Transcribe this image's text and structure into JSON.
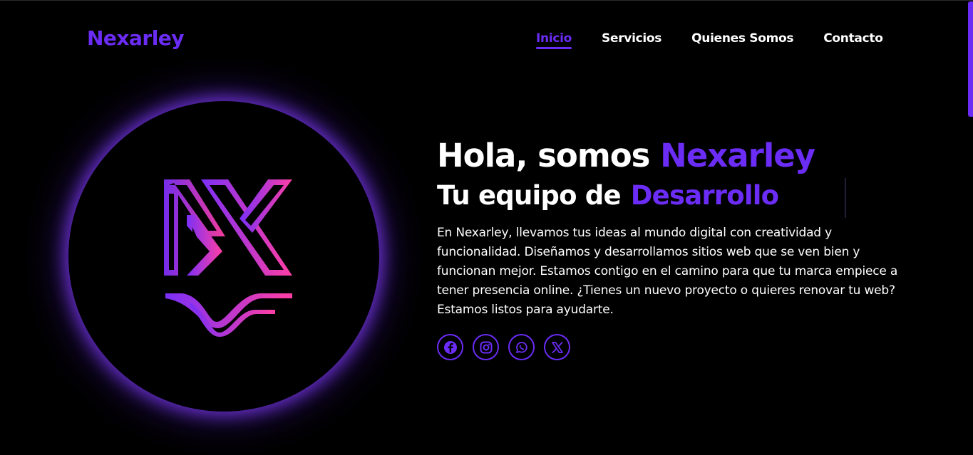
{
  "brand": {
    "name": "Nexarley"
  },
  "nav": {
    "items": [
      {
        "label": "Inicio",
        "active": true
      },
      {
        "label": "Servicios",
        "active": false
      },
      {
        "label": "Quienes Somos",
        "active": false
      },
      {
        "label": "Contacto",
        "active": false
      }
    ]
  },
  "hero": {
    "title_prefix": "Hola, somos ",
    "title_accent": "Nexarley",
    "subtitle_prefix": "Tu equipo de",
    "subtitle_typed": "Desarrollo",
    "description": "En Nexarley, llevamos tus ideas al mundo digital con creatividad y funcionalidad. Diseñamos y desarrollamos sitios web que se ven bien y funcionan mejor. Estamos contigo en el camino para que tu marca empiece a tener presencia online. ¿Tienes un nuevo proyecto o quieres renovar tu web? Estamos listos para ayudarte."
  },
  "socials": [
    {
      "icon": "facebook-icon"
    },
    {
      "icon": "instagram-icon"
    },
    {
      "icon": "whatsapp-icon"
    },
    {
      "icon": "x-twitter-icon"
    }
  ],
  "colors": {
    "accent": "#6b2cf5",
    "background": "#000000",
    "text": "#ffffff",
    "gradient_start": "#7b2ff7",
    "gradient_end": "#ff3fa4"
  }
}
